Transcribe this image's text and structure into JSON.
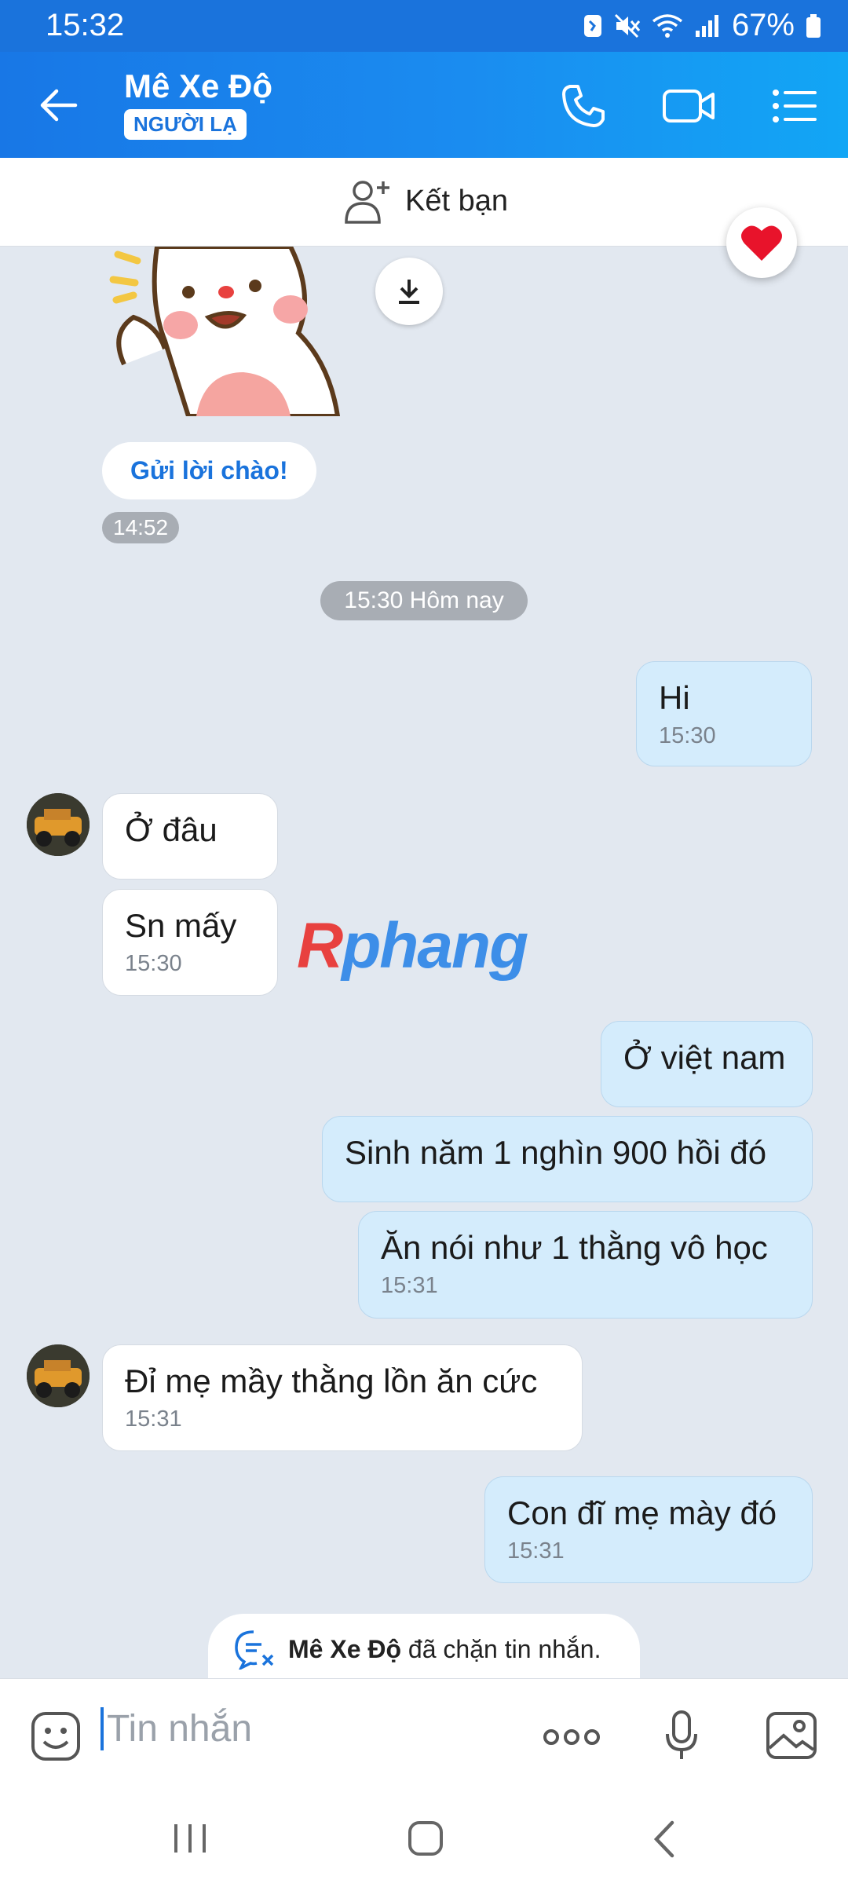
{
  "status_bar": {
    "time": "15:32",
    "battery": "67%"
  },
  "header": {
    "title": "Mê Xe Độ",
    "badge": "NGƯỜI LẠ"
  },
  "friend_bar": {
    "label": "Kết bạn"
  },
  "greeting": {
    "label": "Gửi lời chào!",
    "time": "14:52"
  },
  "day_separator": "15:30 Hôm nay",
  "messages": [
    {
      "side": "out",
      "text": "Hi",
      "time": "15:30"
    },
    {
      "side": "in",
      "text": "Ở đâu",
      "time": ""
    },
    {
      "side": "in",
      "text": "Sn mấy",
      "time": "15:30"
    },
    {
      "side": "out",
      "text": "Ở việt nam",
      "time": ""
    },
    {
      "side": "out",
      "text": "Sinh năm 1 nghìn 900 hồi đó",
      "time": ""
    },
    {
      "side": "out",
      "text": "Ăn nói như 1 thằng vô học",
      "time": "15:31"
    },
    {
      "side": "in",
      "text": "Đỉ mẹ mầy thằng lồn ăn cức",
      "time": "15:31"
    },
    {
      "side": "out",
      "text": "Con đĩ mẹ mày đó",
      "time": "15:31"
    }
  ],
  "watermark": {
    "part1": "R",
    "part2": "phang"
  },
  "blocked_notice": {
    "name": "Mê Xe Độ",
    "text": " đã chặn tin nhắn."
  },
  "input": {
    "placeholder": "Tin nhắn"
  },
  "colors": {
    "accent": "#1a73dc",
    "bubble_out": "#d4ecfc",
    "bubble_in": "#ffffff",
    "background": "#e2e8f0"
  }
}
